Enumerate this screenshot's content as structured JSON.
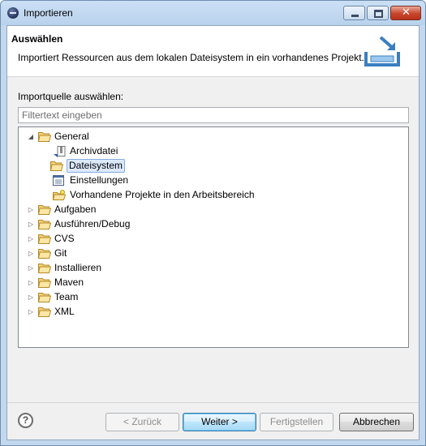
{
  "window": {
    "title": "Importieren"
  },
  "header": {
    "title": "Auswählen",
    "description": "Importiert Ressourcen aus dem lokalen Dateisystem in ein vorhandenes Projekt."
  },
  "source": {
    "label": "Importquelle auswählen:",
    "filter_placeholder": "Filtertext eingeben"
  },
  "tree": {
    "general": {
      "label": "General",
      "children": {
        "archive": "Archivdatei",
        "filesystem": "Dateisystem",
        "preferences": "Einstellungen",
        "existing_projects": "Vorhandene Projekte in den Arbeitsbereich"
      }
    },
    "categories": [
      "Aufgaben",
      "Ausführen/Debug",
      "CVS",
      "Git",
      "Installieren",
      "Maven",
      "Team",
      "XML"
    ]
  },
  "buttons": {
    "help": "?",
    "back": "< Zurück",
    "next": "Weiter >",
    "finish": "Fertigstellen",
    "cancel": "Abbrechen"
  },
  "colors": {
    "selection": "#dbe9fb",
    "folder": "#e8c466"
  }
}
